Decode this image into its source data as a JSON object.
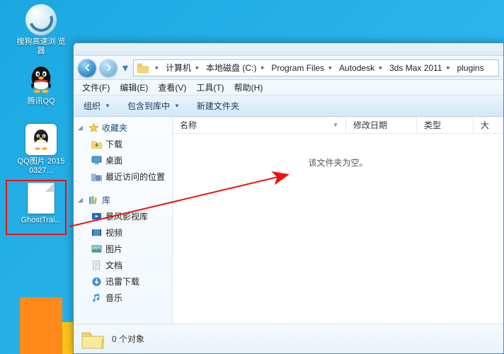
{
  "desktop_icons": {
    "sogou": "搜狗高速浏\n览器",
    "qq": "腾讯QQ",
    "qq_image": "QQ图片\n20150327...",
    "ghost_file": "GhostTrai..."
  },
  "breadcrumb": {
    "parts": [
      "计算机",
      "本地磁盘 (C:)",
      "Program Files",
      "Autodesk",
      "3ds Max 2011",
      "plugins"
    ]
  },
  "menubar": {
    "file": "文件(F)",
    "edit": "编辑(E)",
    "view": "查看(V)",
    "tools": "工具(T)",
    "help": "帮助(H)"
  },
  "toolbar": {
    "organize": "组织",
    "include": "包含到库中",
    "new_folder": "新建文件夹"
  },
  "navpane": {
    "favorites": {
      "title": "收藏夹",
      "downloads": "下载",
      "desktop": "桌面",
      "recent": "最近访问的位置"
    },
    "libraries": {
      "title": "库",
      "storm": "暴风影视库",
      "videos": "视频",
      "pictures": "图片",
      "documents": "文档",
      "xunlei": "迅雷下载",
      "music": "音乐"
    }
  },
  "columns": {
    "name": "名称",
    "date": "修改日期",
    "type": "类型",
    "size": "大"
  },
  "content": {
    "empty_msg": "该文件夹为空。"
  },
  "status": {
    "count": "0 个对象"
  }
}
